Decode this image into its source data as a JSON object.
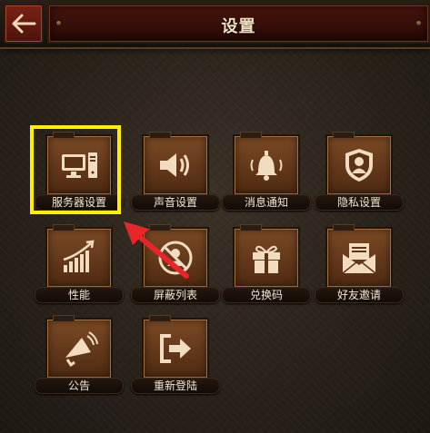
{
  "header": {
    "title": "设置",
    "back_icon": "back-arrow-icon"
  },
  "tiles": [
    {
      "label": "服务器设置",
      "icon": "computer-icon"
    },
    {
      "label": "声音设置",
      "icon": "speaker-icon"
    },
    {
      "label": "消息通知",
      "icon": "bell-icon"
    },
    {
      "label": "隐私设置",
      "icon": "shield-user-icon"
    },
    {
      "label": "性能",
      "icon": "performance-bars-icon"
    },
    {
      "label": "屏蔽列表",
      "icon": "block-icon"
    },
    {
      "label": "兑换码",
      "icon": "gift-icon"
    },
    {
      "label": "好友邀请",
      "icon": "envelope-icon"
    },
    {
      "label": "公告",
      "icon": "megaphone-icon"
    },
    {
      "label": "重新登陆",
      "icon": "relogin-icon"
    }
  ],
  "annotation": {
    "highlight_color": "#ffef00",
    "arrow_color": "#e8262a"
  }
}
